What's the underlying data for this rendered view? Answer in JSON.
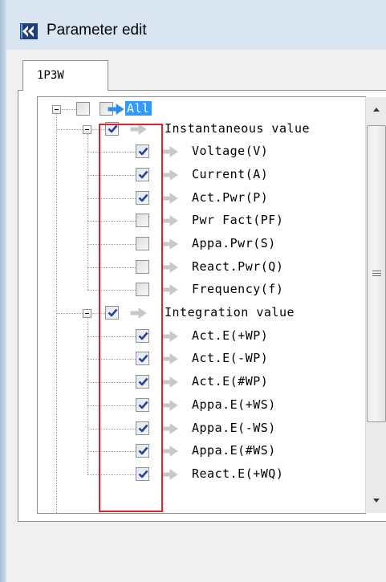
{
  "window": {
    "title": "Parameter edit"
  },
  "tabs": [
    {
      "label": "1P3W",
      "active": true
    }
  ],
  "tree": {
    "root": {
      "label": "All",
      "checked": false,
      "selected": true
    },
    "groups": [
      {
        "label": "Instantaneous value",
        "checked": true,
        "items": [
          {
            "label": "Voltage(V)",
            "checked": true
          },
          {
            "label": "Current(A)",
            "checked": true
          },
          {
            "label": "Act.Pwr(P)",
            "checked": true
          },
          {
            "label": "Pwr Fact(PF)",
            "checked": false
          },
          {
            "label": "Appa.Pwr(S)",
            "checked": false
          },
          {
            "label": "React.Pwr(Q)",
            "checked": false
          },
          {
            "label": "Frequency(f)",
            "checked": false
          }
        ]
      },
      {
        "label": "Integration value",
        "checked": true,
        "items": [
          {
            "label": "Act.E(+WP)",
            "checked": true
          },
          {
            "label": "Act.E(-WP)",
            "checked": true
          },
          {
            "label": "Act.E(#WP)",
            "checked": true
          },
          {
            "label": "Appa.E(+WS)",
            "checked": true
          },
          {
            "label": "Appa.E(-WS)",
            "checked": true
          },
          {
            "label": "Appa.E(#WS)",
            "checked": true
          },
          {
            "label": "React.E(+WQ)",
            "checked": true
          }
        ]
      }
    ]
  },
  "colors": {
    "selection": "#3399ff",
    "highlight_box": "#e0202a",
    "root_arrow": "#2f8fe8",
    "item_arrow": "#c8c8c8"
  },
  "icons": {
    "app": "app-logo-icon",
    "expander": "collapse-minus-icon",
    "checkbox": "checkmark-icon",
    "arrow": "right-arrow-icon"
  }
}
